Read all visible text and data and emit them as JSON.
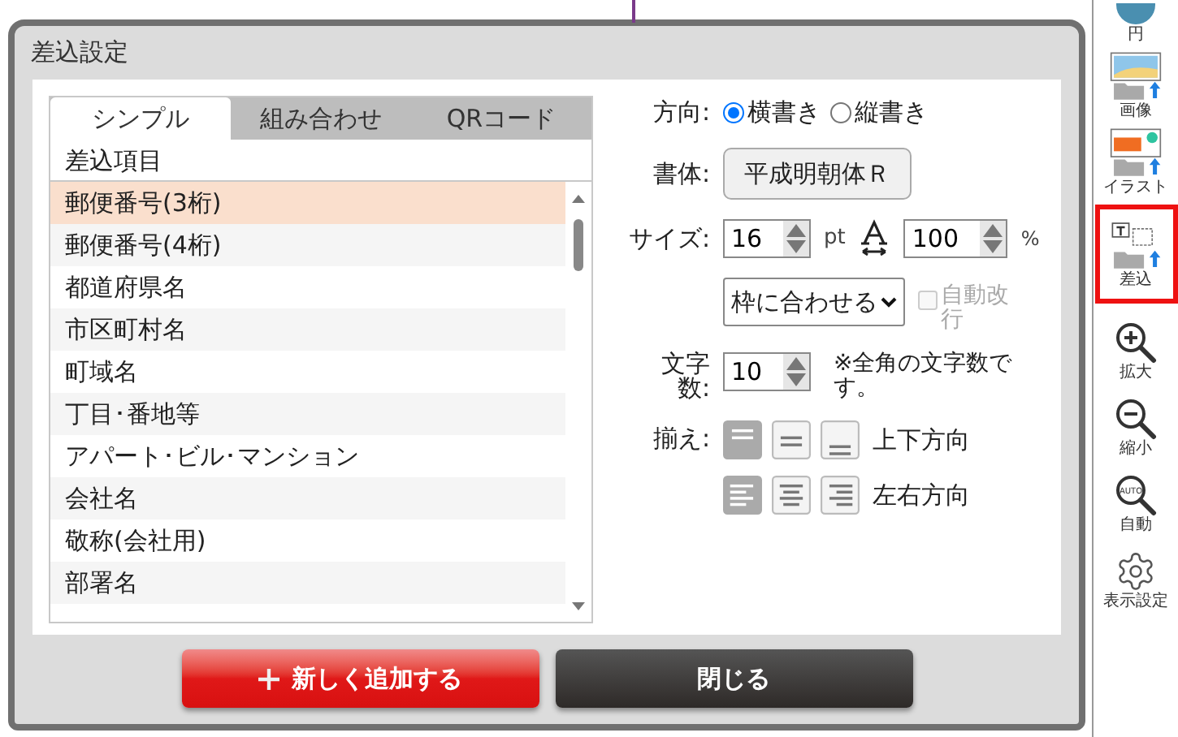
{
  "dialog": {
    "title": "差込設定",
    "tabs": [
      {
        "label": "シンプル",
        "selected": true
      },
      {
        "label": "組み合わせ",
        "selected": false
      },
      {
        "label": "QRコード",
        "selected": false
      }
    ],
    "list": {
      "header": "差込項目",
      "items": [
        {
          "label": "郵便番号(3桁)",
          "selected": true
        },
        {
          "label": "郵便番号(4桁)",
          "selected": false
        },
        {
          "label": "都道府県名",
          "selected": false
        },
        {
          "label": "市区町村名",
          "selected": false
        },
        {
          "label": "町域名",
          "selected": false
        },
        {
          "label": "丁目･番地等",
          "selected": false
        },
        {
          "label": "アパート･ビル･マンション",
          "selected": false
        },
        {
          "label": "会社名",
          "selected": false
        },
        {
          "label": "敬称(会社用)",
          "selected": false
        },
        {
          "label": "部署名",
          "selected": false
        }
      ]
    },
    "direction": {
      "label": "方向:",
      "options": [
        {
          "label": "横書き",
          "selected": true
        },
        {
          "label": "縦書き",
          "selected": false
        }
      ]
    },
    "font": {
      "label": "書体:",
      "value": "平成明朝体Ｒ"
    },
    "size": {
      "label": "サイズ:",
      "value": "16",
      "unit": "pt",
      "scale_value": "100",
      "scale_unit": "%"
    },
    "fit": {
      "value": "枠に合わせる",
      "auto_wrap": {
        "label": "自動改行",
        "checked": false,
        "disabled": true
      }
    },
    "chars": {
      "label": "文字数:",
      "value": "10",
      "note": "※全角の文字数です。"
    },
    "align": {
      "label": "揃え:",
      "rows": [
        {
          "label": "上下方向",
          "kind": "vertical",
          "options": [
            {
              "selected": true
            },
            {
              "selected": false
            },
            {
              "selected": false
            }
          ]
        },
        {
          "label": "左右方向",
          "kind": "horizontal",
          "options": [
            {
              "selected": true
            },
            {
              "selected": false
            },
            {
              "selected": false
            }
          ]
        }
      ]
    },
    "buttons": [
      {
        "label": "新しく追加する",
        "kind": "add"
      },
      {
        "label": "閉じる",
        "kind": "close"
      }
    ]
  },
  "sidebar": {
    "items": [
      {
        "label": "円",
        "kind": "circle",
        "selected": false
      },
      {
        "label": "画像",
        "kind": "image",
        "selected": false
      },
      {
        "label": "イラスト",
        "kind": "illustration",
        "selected": false
      },
      {
        "label": "差込",
        "kind": "merge",
        "selected": true
      },
      {
        "label": "拡大",
        "kind": "zoom_in",
        "selected": false
      },
      {
        "label": "縮小",
        "kind": "zoom_out",
        "selected": false
      },
      {
        "label": "自動",
        "kind": "zoom_auto",
        "badge": "AUTO",
        "selected": false
      },
      {
        "label": "表示設定",
        "kind": "settings",
        "selected": false
      }
    ]
  }
}
